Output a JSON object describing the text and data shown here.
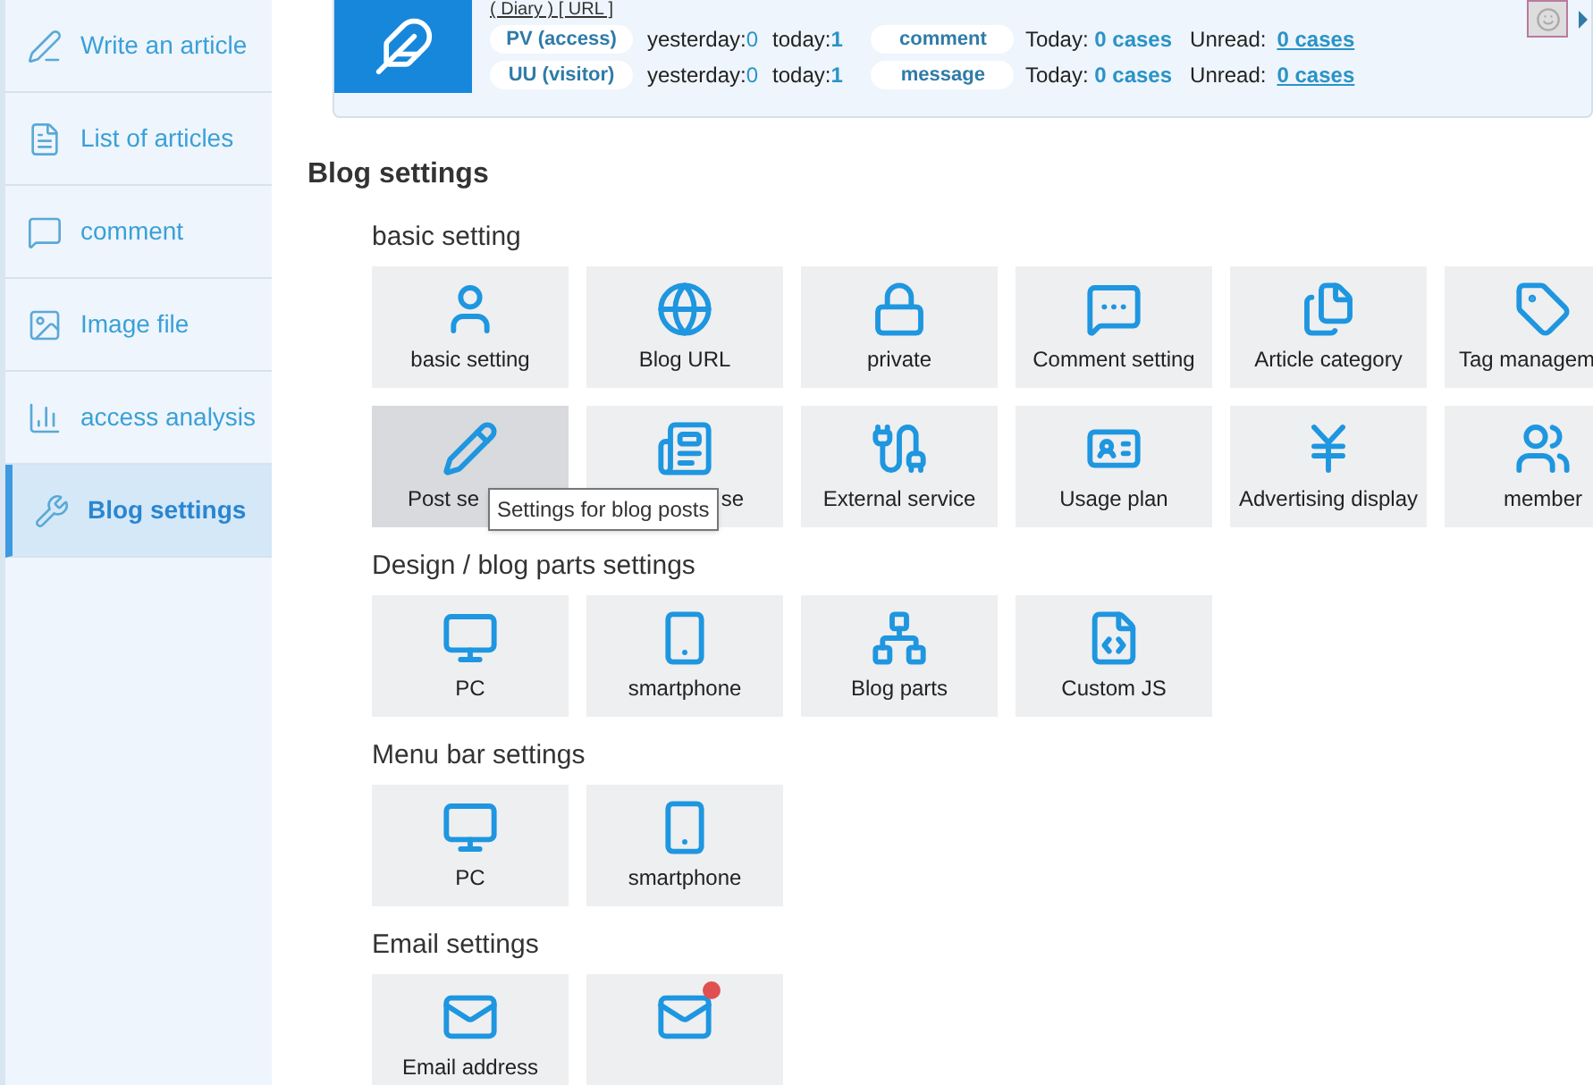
{
  "sidebar": {
    "items": [
      {
        "label": "Write an article",
        "selected": false
      },
      {
        "label": "List of articles",
        "selected": false
      },
      {
        "label": "comment",
        "selected": false
      },
      {
        "label": "Image file",
        "selected": false
      },
      {
        "label": "access analysis",
        "selected": false
      },
      {
        "label": "Blog settings",
        "selected": true
      }
    ]
  },
  "header": {
    "links": "( Diary ) [ URL ]",
    "access": [
      {
        "label": "PV (access)",
        "yesterday_label": "yesterday:",
        "yesterday": "0",
        "today_label": "today:",
        "today": "1"
      },
      {
        "label": "UU (visitor)",
        "yesterday_label": "yesterday:",
        "yesterday": "0",
        "today_label": "today:",
        "today": "1"
      }
    ],
    "inbox": [
      {
        "label": "comment",
        "today_label": "Today:",
        "today": "0 cases",
        "unread_label": "Unread:",
        "unread": "0 cases"
      },
      {
        "label": "message",
        "today_label": "Today:",
        "today": "0 cases",
        "unread_label": "Unread:",
        "unread": "0 cases"
      }
    ]
  },
  "title": "Blog settings",
  "sections": [
    {
      "title": "basic setting",
      "tiles": [
        {
          "label": "basic setting",
          "kind": "full",
          "hover": false
        },
        {
          "label": "Blog URL",
          "kind": "full",
          "hover": false
        },
        {
          "label": "private",
          "kind": "full",
          "hover": false
        },
        {
          "label": "Comment setting",
          "kind": "full",
          "hover": false
        },
        {
          "label": "Article category",
          "kind": "full",
          "hover": false
        },
        {
          "label": "Tag managem",
          "kind": "edge",
          "hover": false
        },
        {
          "label": "Post se",
          "kind": "cut_right",
          "hover": true
        },
        {
          "label": "se",
          "kind": "cut_left",
          "hover": false
        },
        {
          "label": "External service",
          "kind": "full",
          "hover": false
        },
        {
          "label": "Usage plan",
          "kind": "full",
          "hover": false
        },
        {
          "label": "Advertising display",
          "kind": "full",
          "hover": false
        },
        {
          "label": "member",
          "kind": "full",
          "hover": false
        }
      ]
    },
    {
      "title": "Design / blog parts settings",
      "tiles": [
        {
          "label": "PC",
          "kind": "full",
          "hover": false
        },
        {
          "label": "smartphone",
          "kind": "full",
          "hover": false
        },
        {
          "label": "Blog parts",
          "kind": "full",
          "hover": false
        },
        {
          "label": "Custom JS",
          "kind": "full",
          "hover": false
        }
      ]
    },
    {
      "title": "Menu bar settings",
      "tiles": [
        {
          "label": "PC",
          "kind": "full",
          "hover": false
        },
        {
          "label": "smartphone",
          "kind": "full",
          "hover": false
        }
      ]
    },
    {
      "title": "Email settings",
      "tiles": [
        {
          "label": "Email address",
          "kind": "full",
          "hover": false
        },
        {
          "kind": "badge",
          "hover": false
        }
      ]
    }
  ],
  "tooltip": "Settings for blog posts"
}
